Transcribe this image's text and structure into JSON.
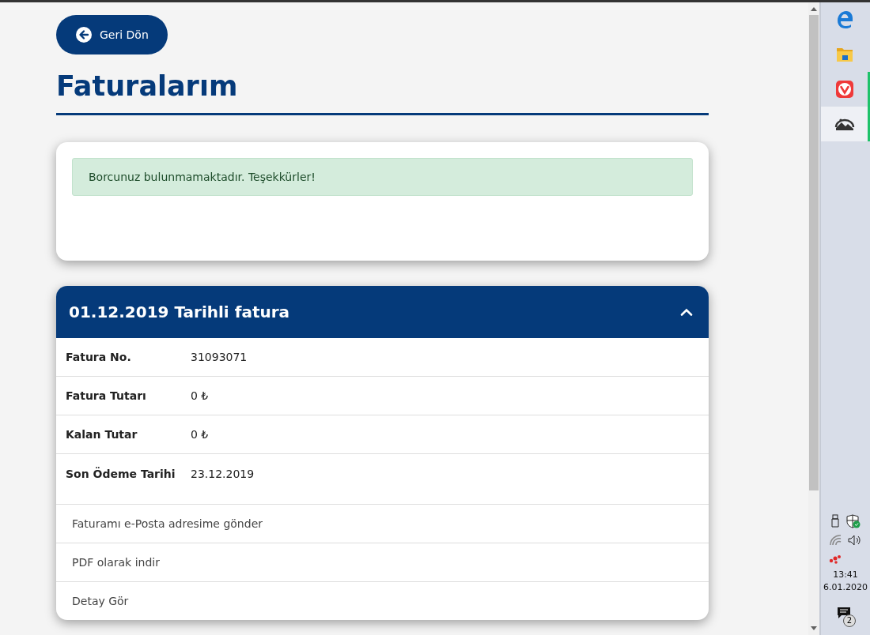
{
  "back_button": {
    "label": "Geri Dön"
  },
  "page_title": "Faturalarım",
  "alert": {
    "message": "Borcunuz bulunmamaktadır. Teşekkürler!"
  },
  "invoice": {
    "title": "01.12.2019 Tarihli fatura",
    "expanded": true,
    "fields": [
      {
        "label": "Fatura No.",
        "value": "31093071"
      },
      {
        "label": "Fatura Tutarı",
        "value": "0 ₺"
      },
      {
        "label": "Kalan Tutar",
        "value": "0 ₺"
      },
      {
        "label": "Son Ödeme Tarihi",
        "value": "23.12.2019"
      }
    ],
    "actions": [
      "Faturamı e-Posta adresime gönder",
      "PDF olarak indir",
      "Detay Gör"
    ]
  },
  "taskbar": {
    "apps": [
      {
        "kind": "edge",
        "running": false,
        "selected": false
      },
      {
        "kind": "folder",
        "running": false,
        "selected": false
      },
      {
        "kind": "vivaldi",
        "running": true,
        "selected": false
      },
      {
        "kind": "photos",
        "running": true,
        "selected": true
      }
    ],
    "time": "13:41",
    "date": "6.01.2020",
    "notifications": "2"
  }
}
